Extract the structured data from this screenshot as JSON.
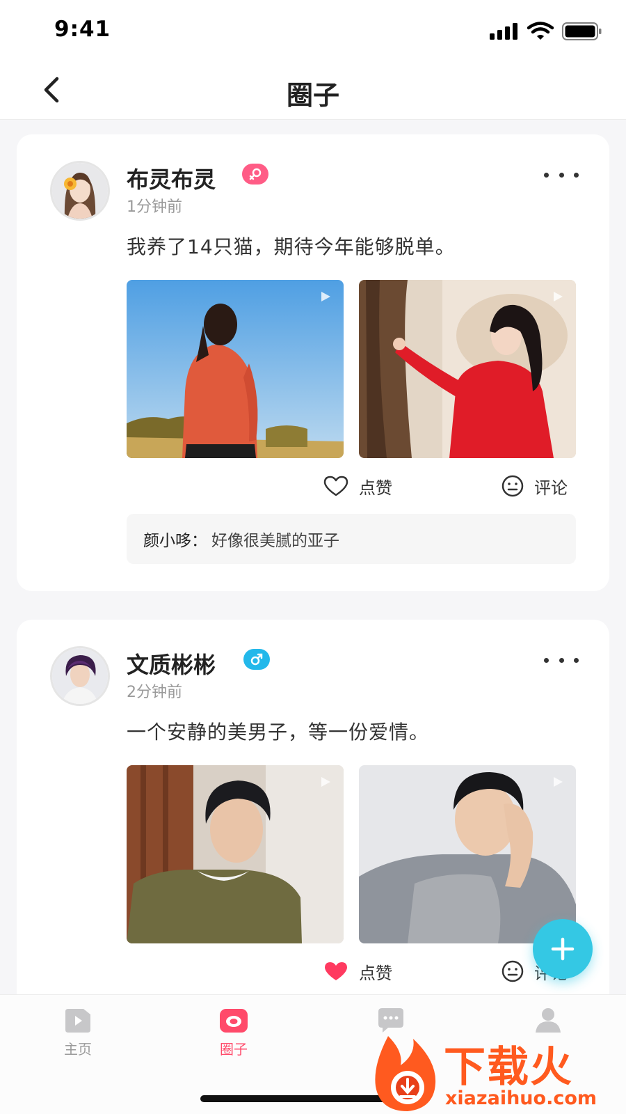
{
  "status_bar": {
    "time": "9:41"
  },
  "nav": {
    "title": "圈子"
  },
  "posts": [
    {
      "user": "布灵布灵",
      "gender": "female",
      "time": "1分钟前",
      "text": "我养了14只猫，期待今年能够脱单。",
      "images": [
        "woman-orange-sweater-sky-photo",
        "woman-red-coat-tree-photo"
      ],
      "actions": {
        "like": "点赞",
        "comment": "评论"
      },
      "liked": false,
      "comment": {
        "author": "颜小哆",
        "separator": "：",
        "text": "好像很美腻的亚子"
      }
    },
    {
      "user": "文质彬彬",
      "gender": "male",
      "time": "2分钟前",
      "text": "一个安静的美男子，等一份爱情。",
      "images": [
        "man-green-sweater-photo",
        "man-grey-jacket-photo"
      ],
      "actions": {
        "like": "点赞",
        "comment": "评论"
      },
      "liked": true
    }
  ],
  "tabs": [
    {
      "label": "主页",
      "icon": "video-icon",
      "active": false
    },
    {
      "label": "圈子",
      "icon": "camera-icon",
      "active": true
    },
    {
      "label": "",
      "icon": "chat-icon",
      "active": false
    },
    {
      "label": "",
      "icon": "user-icon",
      "active": false
    }
  ],
  "watermark": {
    "main": "下载火",
    "sub": "xiazaihuo.com"
  },
  "colors": {
    "accent": "#ff4a6a",
    "fab": "#34c8e4",
    "female": "#ff5c86",
    "male": "#23b8ea",
    "watermark": "#ff5a1f"
  }
}
